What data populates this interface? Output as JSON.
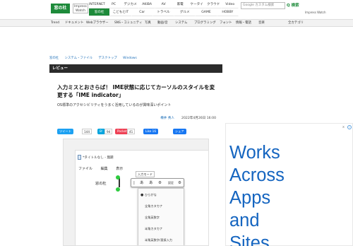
{
  "header": {
    "logo_text": "窓の杜",
    "watch_label": "Impress Watch",
    "nav_row1": [
      "INTERNET",
      "PC",
      "デジカメ",
      "AKIBA",
      "AV",
      "家電",
      "ケータイ",
      "クラウド",
      "Video"
    ],
    "nav_row2": [
      "窓の杜",
      "こどもとIT",
      "Car",
      "トラベル",
      "グルメ",
      "GAME",
      "HOBBY"
    ],
    "search_placeholder": "Google カスタム検索",
    "search_button": "Q 検索",
    "badge": "Impress Watch"
  },
  "subnav": [
    "Trend",
    "ドキュメント",
    "Webブラウザー",
    "SNS・コミュニティ",
    "写真",
    "動画/音",
    "システム",
    "プログラミング",
    "フォント",
    "情報・電話",
    "音楽",
    "全カテゴリ"
  ],
  "breadcrumb": [
    "窓の杜",
    "システム・ファイル",
    "デスクトップ",
    "Windows"
  ],
  "section": "レビュー",
  "article": {
    "title": "入力ミスとおさらば！ IME状態に応じてカーソルのスタイルを変更する「IME indicator」",
    "lead": "OS標準のアクセシビリティをうまく活用しているのが興味深いポイント",
    "author": "樽井 秀人",
    "date": "2022年4月26日 16:00"
  },
  "share": {
    "tweet": "ツイート",
    "tweet_count": "144",
    "hatena": "B!",
    "hatena_count": "94",
    "pocket": "Pocket",
    "pocket_count": "41",
    "like": "Like 16",
    "share": "シェア"
  },
  "figure": {
    "window_title": "*タイトルなし - 無題",
    "menu": [
      "ファイル",
      "編集",
      "表示"
    ],
    "input_text": "窓の杜",
    "tooltip": "入力モード",
    "ime_bar": [
      "|",
      "あ",
      "あ",
      "⚙",
      "日",
      "設定"
    ],
    "ime_options": [
      "ひらがな",
      "全角カタカナ",
      "全角英数字",
      "半角カタカナ",
      "半角英数字/直接入力"
    ]
  },
  "ad": {
    "text": "Works\nAcross\nApps\nand\nSites",
    "info_icon": "i",
    "close_icon": "x"
  }
}
